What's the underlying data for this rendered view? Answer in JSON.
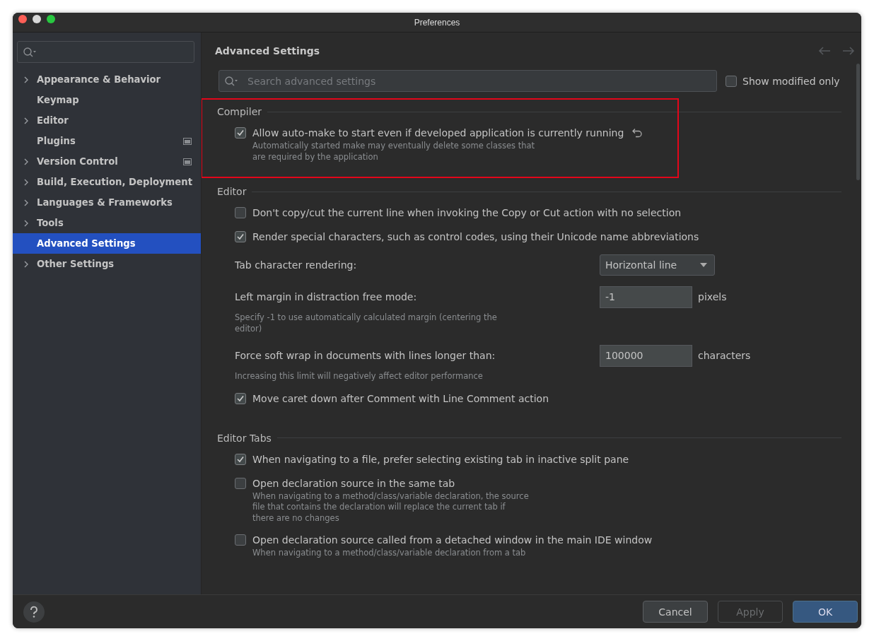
{
  "window": {
    "title": "Preferences"
  },
  "sidebar": {
    "items": [
      {
        "label": "Appearance & Behavior",
        "expandable": true,
        "selected": false,
        "badge": false
      },
      {
        "label": "Keymap",
        "expandable": false,
        "selected": false,
        "badge": false
      },
      {
        "label": "Editor",
        "expandable": true,
        "selected": false,
        "badge": false
      },
      {
        "label": "Plugins",
        "expandable": false,
        "selected": false,
        "badge": true
      },
      {
        "label": "Version Control",
        "expandable": true,
        "selected": false,
        "badge": true
      },
      {
        "label": "Build, Execution, Deployment",
        "expandable": true,
        "selected": false,
        "badge": false
      },
      {
        "label": "Languages & Frameworks",
        "expandable": true,
        "selected": false,
        "badge": false
      },
      {
        "label": "Tools",
        "expandable": true,
        "selected": false,
        "badge": false
      },
      {
        "label": "Advanced Settings",
        "expandable": false,
        "selected": true,
        "badge": false
      },
      {
        "label": "Other Settings",
        "expandable": true,
        "selected": false,
        "badge": false
      }
    ]
  },
  "page": {
    "title": "Advanced Settings",
    "search": {
      "placeholder": "Search advanced settings"
    },
    "show_modified_only": {
      "label": "Show modified only",
      "checked": false
    }
  },
  "sections": [
    {
      "title": "Compiler",
      "highlighted": true,
      "items": [
        {
          "kind": "checkbox",
          "label": "Allow auto-make to start even if developed application is currently running",
          "checked": true,
          "modified": true,
          "description": [
            "Automatically started make may eventually delete some classes that",
            "are required by the application"
          ]
        }
      ]
    },
    {
      "title": "Editor",
      "highlighted": false,
      "items": [
        {
          "kind": "checkbox",
          "label": "Don't copy/cut the current line when invoking the Copy or Cut action with no selection",
          "checked": false,
          "modified": false
        },
        {
          "kind": "checkbox",
          "label": "Render special characters, such as control codes, using their Unicode name abbreviations",
          "checked": true,
          "modified": false
        },
        {
          "kind": "dropdown",
          "label": "Tab character rendering:",
          "value": "Horizontal line"
        },
        {
          "kind": "number",
          "label": "Left margin in distraction free mode:",
          "value": "-1",
          "unit": "pixels",
          "description": [
            "Specify -1 to use automatically calculated margin (centering the",
            "editor)"
          ]
        },
        {
          "kind": "number",
          "label": "Force soft wrap in documents with lines longer than:",
          "value": "100000",
          "unit": "characters",
          "description": [
            "Increasing this limit will negatively affect editor performance"
          ]
        },
        {
          "kind": "checkbox",
          "label": "Move caret down after Comment with Line Comment action",
          "checked": true,
          "modified": false
        }
      ]
    },
    {
      "title": "Editor Tabs",
      "highlighted": false,
      "items": [
        {
          "kind": "checkbox",
          "label": "When navigating to a file, prefer selecting existing tab in inactive split pane",
          "checked": true,
          "modified": false
        },
        {
          "kind": "checkbox",
          "label": "Open declaration source in the same tab",
          "checked": false,
          "modified": false,
          "description": [
            "When navigating to a method/class/variable declaration, the source",
            "file that contains the declaration will replace the current tab if",
            "there are no changes"
          ]
        },
        {
          "kind": "checkbox",
          "label": "Open declaration source called from a detached window in the main IDE window",
          "checked": false,
          "modified": false,
          "description": [
            "When navigating to a method/class/variable declaration from a tab"
          ]
        }
      ]
    }
  ],
  "buttons": [
    {
      "label": "Cancel",
      "kind": "normal"
    },
    {
      "label": "Apply",
      "kind": "disabled"
    },
    {
      "label": "OK",
      "kind": "default"
    }
  ]
}
